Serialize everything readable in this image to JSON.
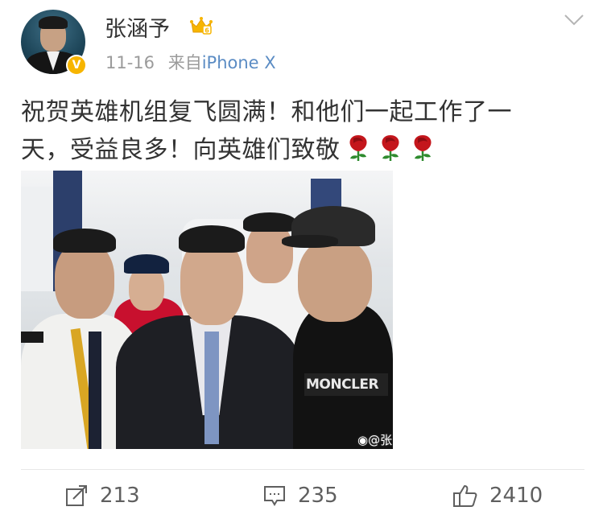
{
  "post": {
    "author": "张涵予",
    "verified_mark": "V",
    "date": "11-16",
    "source_prefix": "来自",
    "source_device": "iPhone X",
    "text_line1": "祝贺英雄机组复飞圆满！和他们一起工作了一",
    "text_line2": "天，受益良多！向英雄们致敬",
    "watermark": "@张",
    "clothing_text": "MONCLER"
  },
  "actions": {
    "share_count": "213",
    "comment_count": "235",
    "like_count": "2410"
  },
  "icons": {
    "vip": "crown-vip-icon",
    "menu": "chevron-down-icon",
    "share": "share-icon",
    "comment": "comment-icon",
    "like": "thumbs-up-icon",
    "emoji": "rose-icon"
  },
  "colors": {
    "text": "#333333",
    "meta": "#9b9b9b",
    "link": "#5b8cc4",
    "vip": "#f7b500",
    "actions": "#5f5f5f"
  }
}
